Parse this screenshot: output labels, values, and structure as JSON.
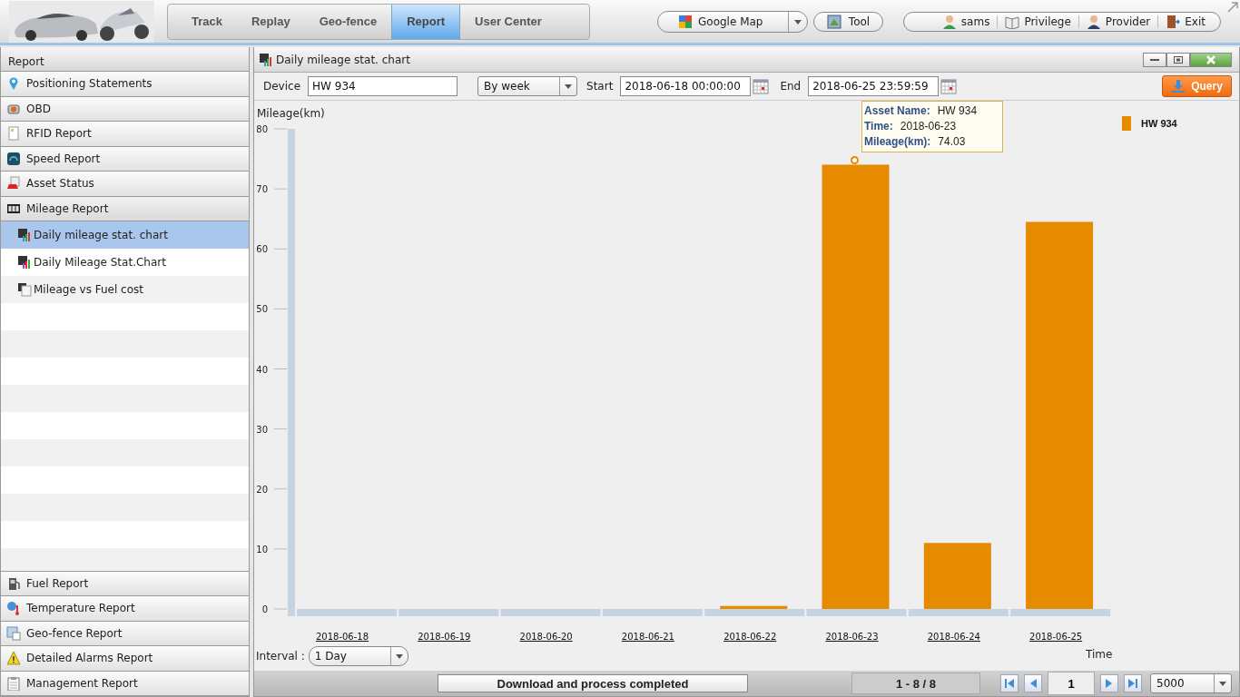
{
  "header": {
    "nav_tabs": [
      {
        "label": "Track",
        "selected": false
      },
      {
        "label": "Replay",
        "selected": false
      },
      {
        "label": "Geo-fence",
        "selected": false
      },
      {
        "label": "Report",
        "selected": true
      },
      {
        "label": "User Center",
        "selected": false
      }
    ],
    "map_selector": "Google Map",
    "tool_button": "Tool",
    "user_menu": [
      "sams",
      "Privilege",
      "Provider",
      "Exit"
    ]
  },
  "sidebar": {
    "title": "Report",
    "items": [
      {
        "label": "Positioning Statements"
      },
      {
        "label": "OBD"
      },
      {
        "label": "RFID Report"
      },
      {
        "label": "Speed Report"
      },
      {
        "label": "Asset Status"
      },
      {
        "label": "Mileage Report",
        "children": [
          {
            "label": "Daily mileage stat. chart",
            "selected": true
          },
          {
            "label": "Daily Mileage Stat.Chart",
            "selected": false
          },
          {
            "label": "Mileage vs Fuel cost",
            "selected": false
          }
        ]
      }
    ],
    "bottom_items": [
      {
        "label": "Fuel Report"
      },
      {
        "label": "Temperature Report"
      },
      {
        "label": "Geo-fence Report"
      },
      {
        "label": "Detailed Alarms Report"
      },
      {
        "label": "Management Report"
      }
    ]
  },
  "panel": {
    "title": "Daily mileage stat. chart",
    "toolbar": {
      "device_label": "Device",
      "device": "HW 934",
      "period": "By week",
      "start_label": "Start",
      "start": "2018-06-18 00:00:00",
      "end_label": "End",
      "end": "2018-06-25 23:59:59",
      "query_button": "Query"
    },
    "chart_data": {
      "type": "bar",
      "ylabel": "Mileage(km)",
      "xlabel": "Time",
      "categories": [
        "2018-06-18",
        "2018-06-19",
        "2018-06-20",
        "2018-06-21",
        "2018-06-22",
        "2018-06-23",
        "2018-06-24",
        "2018-06-25"
      ],
      "series": [
        {
          "name": "HW 934",
          "color": "#e68a00",
          "values": [
            0,
            0,
            0,
            0,
            0.5,
            74.03,
            11,
            64.5
          ]
        }
      ],
      "ylim": [
        0,
        80
      ],
      "yticks": [
        0,
        10,
        20,
        30,
        40,
        50,
        60,
        70,
        80
      ]
    },
    "tooltip": [
      {
        "label": "Asset Name:",
        "value": "HW 934"
      },
      {
        "label": "Time:",
        "value": "2018-06-23"
      },
      {
        "label": "Mileage(km):",
        "value": "74.03"
      }
    ],
    "interval_label": "Interval :",
    "interval": "1 Day",
    "status": {
      "message": "Download and process completed",
      "range": "1 - 8 / 8",
      "page": "1",
      "page_size": "5000"
    }
  }
}
